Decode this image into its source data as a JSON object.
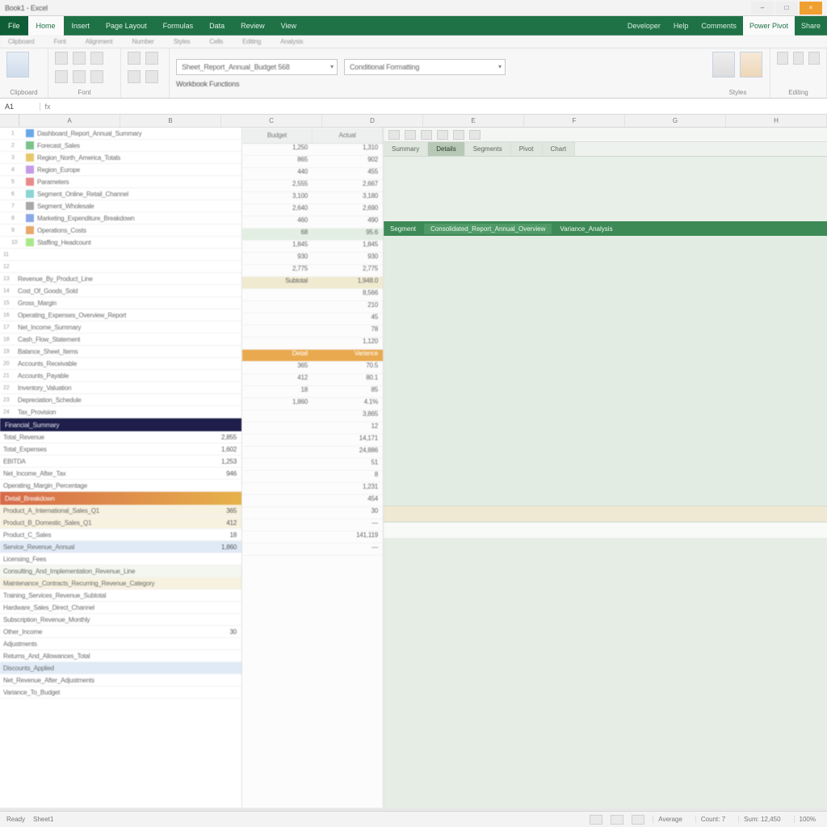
{
  "titlebar": {
    "title": "Book1 - Excel",
    "min": "–",
    "max": "□",
    "close": "×"
  },
  "ribbon": {
    "file": "File",
    "tabs": [
      "Home",
      "Insert",
      "Page Layout",
      "Formulas",
      "Data",
      "Review",
      "View",
      "Developer",
      "Help",
      "Power Pivot"
    ],
    "active_tab": "Home",
    "right_tools": [
      "Comments",
      "Share"
    ],
    "subrow": [
      "Clipboard",
      "Font",
      "Alignment",
      "Number",
      "Styles",
      "Cells",
      "Editing",
      "Analysis"
    ],
    "groups": {
      "g1": "Clipboard",
      "g2": "Font",
      "g3": "Styles",
      "g4": "Editing"
    },
    "name_combo": "Sheet_Report_Annual_Budget   568",
    "style_combo": "Conditional Formatting",
    "group_sub": "Workbook  Functions"
  },
  "fx": {
    "namebox": "A1",
    "icon": "fx",
    "formula": ""
  },
  "colheads": [
    "A",
    "B",
    "C",
    "D",
    "E",
    "F",
    "G",
    "H"
  ],
  "leftpane": {
    "rows_top": [
      "Dashboard_Report_Annual_Summary",
      "Forecast_Sales",
      "Region_North_America_Totals",
      "Region_Europe",
      "Parameters",
      "Segment_Online_Retail_Channel",
      "Segment_Wholesale",
      "Marketing_Expenditure_Breakdown",
      "Operations_Costs",
      "Staffing_Headcount"
    ],
    "rows_blank": 2,
    "rows_mid": [
      "Revenue_By_Product_Line",
      "Cost_Of_Goods_Sold",
      "Gross_Margin",
      "Operating_Expenses_Overview_Report",
      "Net_Income_Summary",
      "Cash_Flow_Statement",
      "Balance_Sheet_Items",
      "Accounts_Receivable",
      "Accounts_Payable",
      "Inventory_Valuation",
      "Depreciation_Schedule",
      "Tax_Provision"
    ],
    "navy": {
      "label": "Financial_Summary",
      "val": ""
    },
    "after_navy": [
      {
        "label": "Total_Revenue",
        "val": "2,855"
      },
      {
        "label": "Total_Expenses",
        "val": "1,602"
      },
      {
        "label": "EBITDA",
        "val": "1,253"
      },
      {
        "label": "Net_Income_After_Tax",
        "val": "946"
      },
      {
        "label": "Operating_Margin_Percentage",
        "val": ""
      }
    ],
    "red": "Detail_Breakdown",
    "after_red": [
      {
        "label": "Product_A_International_Sales_Q1",
        "val": "365",
        "band": "band-cream"
      },
      {
        "label": "Product_B_Domestic_Sales_Q1",
        "val": "412",
        "band": "band-cream"
      },
      {
        "label": "Product_C_Sales",
        "val": "18",
        "band": ""
      },
      {
        "label": "Service_Revenue_Annual",
        "val": "1,860",
        "band": "band-blue"
      },
      {
        "label": "Licensing_Fees",
        "val": "",
        "band": ""
      },
      {
        "label": "Consulting_And_Implementation_Revenue_Line",
        "val": "",
        "band": "band-pale"
      },
      {
        "label": "Maintenance_Contracts_Recurring_Revenue_Category",
        "val": "",
        "band": "band-cream"
      },
      {
        "label": "Training_Services_Revenue_Subtotal",
        "val": "",
        "band": ""
      },
      {
        "label": "Hardware_Sales_Direct_Channel",
        "val": "",
        "band": ""
      },
      {
        "label": "Subscription_Revenue_Monthly",
        "val": "",
        "band": ""
      },
      {
        "label": "Other_Income",
        "val": "30",
        "band": ""
      },
      {
        "label": "Adjustments",
        "val": "",
        "band": ""
      },
      {
        "label": "Returns_And_Allowances_Total",
        "val": "",
        "band": ""
      },
      {
        "label": "Discounts_Applied",
        "val": "",
        "band": "band-blue"
      },
      {
        "label": "Net_Revenue_After_Adjustments",
        "val": "",
        "band": ""
      },
      {
        "label": "Variance_To_Budget",
        "val": "",
        "band": ""
      }
    ]
  },
  "midpane": {
    "head": [
      "Budget",
      "Actual"
    ],
    "blocks": [
      {
        "rows": [
          [
            "1,250",
            "1,310"
          ],
          [
            "865",
            "902"
          ],
          [
            "440",
            "455"
          ],
          [
            "2,555",
            "2,667"
          ]
        ],
        "cls": ""
      },
      {
        "rows": [
          [
            "3,100",
            "3,180"
          ],
          [
            "2,640",
            "2,690"
          ],
          [
            "460",
            "490"
          ]
        ],
        "cls": ""
      },
      {
        "rows": [
          [
            "68",
            "95.6"
          ]
        ],
        "cls": "hband-green"
      },
      {
        "rows": [
          [
            "1,845",
            "1,845"
          ],
          [
            "930",
            "930"
          ],
          [
            "2,775",
            "2,775"
          ]
        ],
        "cls": ""
      },
      {
        "rows": [
          [
            "Subtotal",
            "1,948.0"
          ]
        ],
        "cls": "hband-ol"
      },
      {
        "rows": [
          [
            "",
            "8,566"
          ],
          [
            "",
            "210"
          ],
          [
            "",
            "45"
          ],
          [
            "",
            "78"
          ],
          [
            "",
            "1,120"
          ]
        ],
        "cls": ""
      },
      {
        "rows": [
          [
            "Detail",
            "Variance"
          ]
        ],
        "cls": "orange-head"
      },
      {
        "rows": [
          [
            "365",
            "70.5"
          ],
          [
            "412",
            "80.1"
          ],
          [
            "18",
            "85"
          ],
          [
            "1,860",
            "4.1%"
          ],
          [
            "",
            "3,865"
          ],
          [
            "",
            "12"
          ],
          [
            "",
            "14,171"
          ],
          [
            "",
            "24,886"
          ],
          [
            "",
            "51"
          ],
          [
            "",
            "8"
          ],
          [
            "",
            "1,231"
          ],
          [
            "",
            "454"
          ],
          [
            "",
            "30"
          ],
          [
            "",
            "—"
          ],
          [
            "",
            "141,119"
          ],
          [
            "",
            "—"
          ]
        ],
        "cls": ""
      }
    ]
  },
  "rightpane": {
    "toolbar_buttons": 6,
    "tabs": [
      "Summary",
      "Details",
      "Segments",
      "Pivot",
      "Chart"
    ],
    "selected_tab": 1,
    "greenbar": [
      "Segment",
      "Consolidated_Report_Annual_Overview",
      "Variance_Analysis"
    ],
    "strip_cream": "",
    "strip_white": ""
  },
  "statusbar": {
    "left": "Ready",
    "sheet_tabs_hint": "Sheet1",
    "segs": [
      "Average",
      "Count: 7",
      "Sum: 12,450",
      "100%"
    ]
  }
}
